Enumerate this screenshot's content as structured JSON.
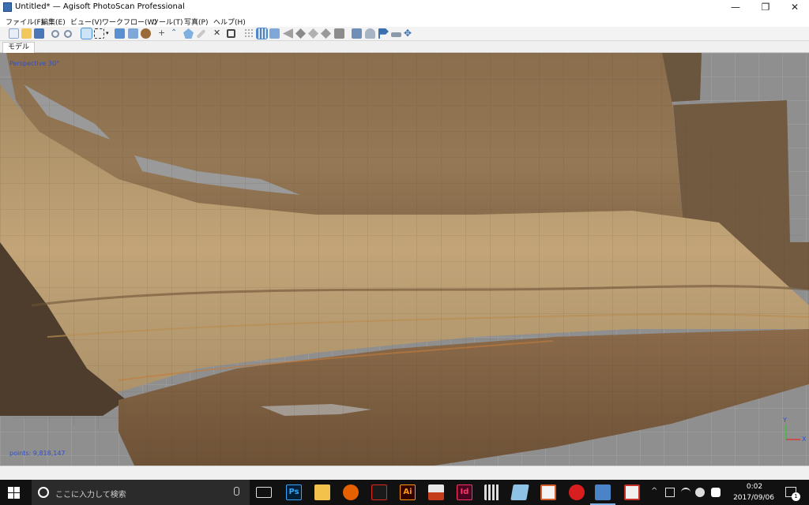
{
  "window": {
    "title": "Untitled* — Agisoft PhotoScan Professional",
    "minimize": "—",
    "maximize": "❐",
    "close": "✕"
  },
  "menu": [
    "ファイル(F)",
    "編集(E)",
    "ビュー(V)",
    "ワークフロー(W)",
    "ツール(T)",
    "写真(P)",
    "ヘルプ(H)"
  ],
  "toolbar": {
    "icons": [
      "new-icon",
      "open-icon",
      "save-icon",
      "undo-icon",
      "redo-icon",
      "navigation-icon",
      "rectangle-selection-icon",
      "dropdown-icon",
      "resize-region-icon",
      "rotate-region-icon",
      "rotate-object-icon",
      "draw-point-icon",
      "draw-polyline-icon",
      "draw-polygon-icon",
      "ruler-icon",
      "delete-icon",
      "crop-icon",
      "point-cloud-icon",
      "mesh-icon",
      "solid-icon",
      "shaded-icon",
      "textured-icon",
      "tiled-icon",
      "dem-icon",
      "cameras-icon",
      "markers-icon",
      "region-icon",
      "trackball-icon",
      "navigate-icon"
    ]
  },
  "tabs": {
    "model": "モデル"
  },
  "viewport": {
    "label": "Perspective 30°",
    "points": "points: 9,818,147",
    "axis_y": "Y",
    "axis_x": "X"
  },
  "taskbar": {
    "search_placeholder": "ここに入力して検索",
    "apps": [
      {
        "name": "task-view-icon",
        "label": ""
      },
      {
        "name": "photoshop-icon",
        "label": "Ps",
        "color": "#31a8ff"
      },
      {
        "name": "file-explorer-icon",
        "label": ""
      },
      {
        "name": "firefox-icon",
        "label": ""
      },
      {
        "name": "acrobat-icon",
        "label": ""
      },
      {
        "name": "illustrator-icon",
        "label": "Ai",
        "color": "#ff9a00"
      },
      {
        "name": "powerpoint-icon",
        "label": ""
      },
      {
        "name": "indesign-icon",
        "label": "Id",
        "color": "#ff3366"
      },
      {
        "name": "calculator-icon",
        "label": ""
      },
      {
        "name": "photos-icon",
        "label": ""
      },
      {
        "name": "paint-icon",
        "label": ""
      },
      {
        "name": "security-icon",
        "label": ""
      },
      {
        "name": "photoscan-icon",
        "label": ""
      },
      {
        "name": "snipping-tool-icon",
        "label": ""
      }
    ],
    "time": "0:02",
    "date": "2017/09/06",
    "notification_count": "1"
  },
  "colors": {
    "accent": "#4a90d9",
    "viewport_bg": "#8f8f8f",
    "label_blue": "#2f4fd0",
    "taskbar": "#111111"
  }
}
